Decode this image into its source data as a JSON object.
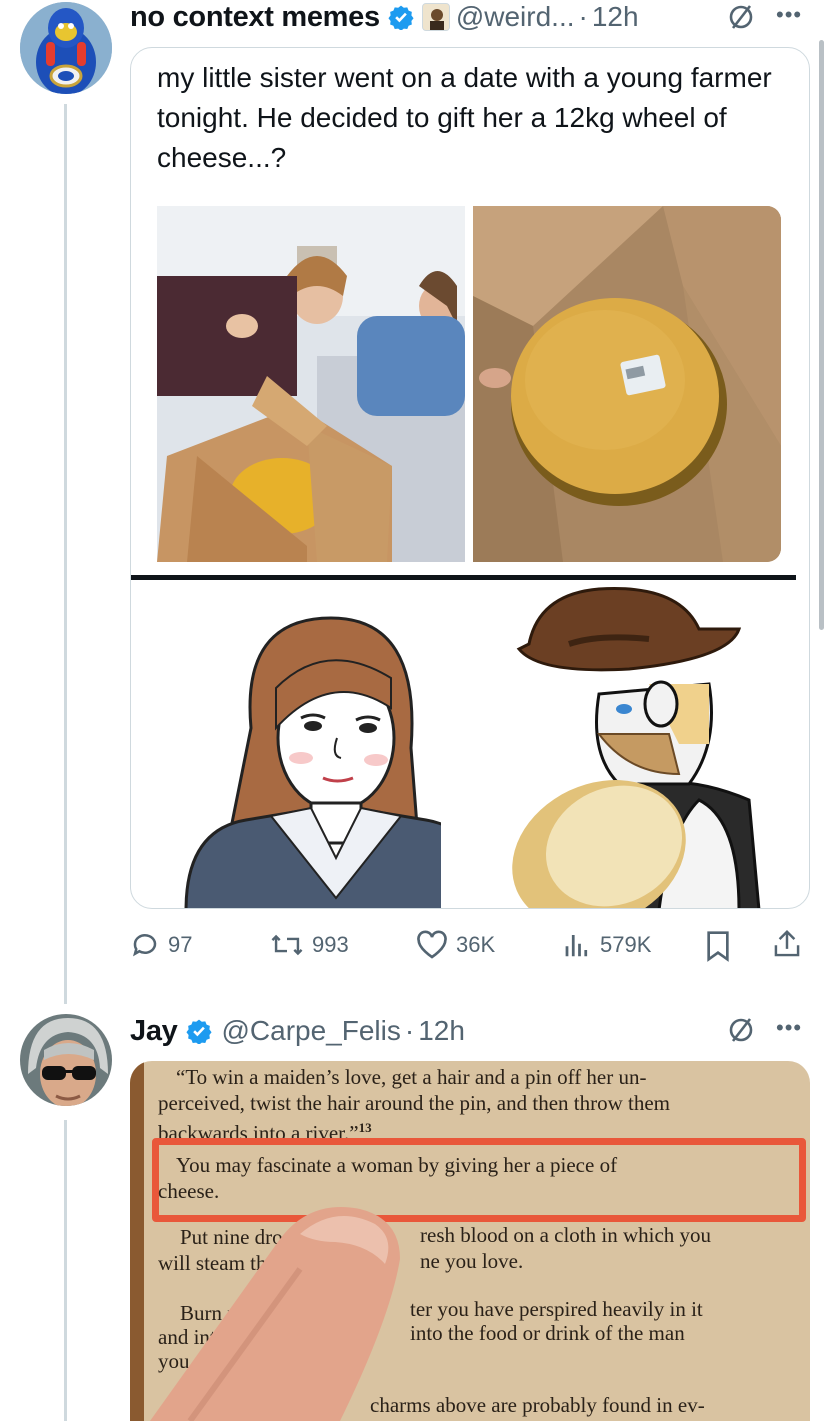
{
  "tweet1": {
    "author_name": "no context memes",
    "handle": "@weird...",
    "separator": "·",
    "time": "12h",
    "quoted_text": "my little sister went on a date with a young farmer tonight. He decided to gift her a 12kg wheel of cheese...?",
    "icons": {
      "verified": "verified-badge-icon",
      "grok": "grok-icon",
      "more": "more-icon"
    },
    "stats": {
      "replies": "97",
      "reposts": "993",
      "likes": "36K",
      "views": "579K"
    }
  },
  "tweet2": {
    "author_name": "Jay",
    "handle": "@Carpe_Felis",
    "separator": "·",
    "time": "12h",
    "book_page": {
      "line1": "“To win a maiden’s love, get a hair and a pin off her un-",
      "line2": "perceived, twist the hair around the pin, and then throw them",
      "line3": "backwards into a river.”",
      "footnote": "13",
      "highlight_line1": "You may fascinate a woman by giving her a piece of",
      "highlight_line2": "cheese.",
      "p2a_left": "Put nine dro",
      "p2a_right": "resh blood on a cloth in which you",
      "p2b_left": "will steam th",
      "p2b_right": "ne you love.",
      "p3a_left": "Burn p",
      "p3a_right": "ter you have perspired heavily in it",
      "p3b_left": "and int",
      "p3b_right": "into the food or drink of the man",
      "p3c_left": "you a",
      "p4": "charms above are probably found in ev-"
    }
  },
  "colors": {
    "verified_blue": "#1d9bf0",
    "muted_text": "#536471",
    "highlight_red": "#e9573a",
    "thread_line": "#cfd9de"
  }
}
